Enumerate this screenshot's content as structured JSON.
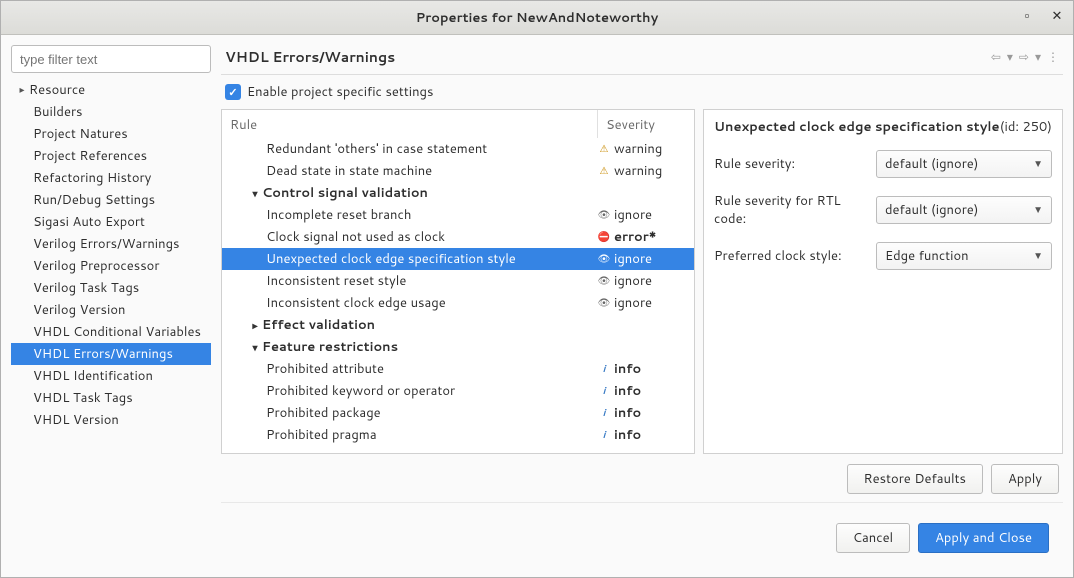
{
  "window": {
    "title": "Properties for NewAndNoteworthy"
  },
  "filter": {
    "placeholder": "type filter text"
  },
  "tree": {
    "items": [
      {
        "label": "Resource",
        "expandable": true,
        "level": 0
      },
      {
        "label": "Builders",
        "level": 1
      },
      {
        "label": "Project Natures",
        "level": 1
      },
      {
        "label": "Project References",
        "level": 1
      },
      {
        "label": "Refactoring History",
        "level": 1
      },
      {
        "label": "Run/Debug Settings",
        "level": 1
      },
      {
        "label": "Sigasi Auto Export",
        "level": 1
      },
      {
        "label": "Verilog Errors/Warnings",
        "level": 1
      },
      {
        "label": "Verilog Preprocessor",
        "level": 1
      },
      {
        "label": "Verilog Task Tags",
        "level": 1
      },
      {
        "label": "Verilog Version",
        "level": 1
      },
      {
        "label": "VHDL Conditional Variables",
        "level": 1
      },
      {
        "label": "VHDL Errors/Warnings",
        "level": 1,
        "selected": true
      },
      {
        "label": "VHDL Identification",
        "level": 1
      },
      {
        "label": "VHDL Task Tags",
        "level": 1
      },
      {
        "label": "VHDL Version",
        "level": 1
      }
    ]
  },
  "page": {
    "title": "VHDL Errors/Warnings",
    "enable_label": "Enable project specific settings",
    "enable_checked": true
  },
  "rules": {
    "header": {
      "rule": "Rule",
      "severity": "Severity"
    },
    "rows": [
      {
        "name": "Redundant 'others' in case statement",
        "indent": 2,
        "sev": "warning",
        "sevkind": "warning"
      },
      {
        "name": "Dead state in state machine",
        "indent": 2,
        "sev": "warning",
        "sevkind": "warning"
      },
      {
        "name": "Control signal validation",
        "indent": 1,
        "bold": true,
        "expandable": true,
        "expanded": true
      },
      {
        "name": "Incomplete reset branch",
        "indent": 2,
        "sev": "ignore",
        "sevkind": "ignore"
      },
      {
        "name": "Clock signal not used as clock",
        "indent": 2,
        "sev": "error*",
        "sevkind": "error"
      },
      {
        "name": "Unexpected clock edge specification style",
        "indent": 2,
        "sev": "ignore",
        "sevkind": "ignore",
        "selected": true
      },
      {
        "name": "Inconsistent reset style",
        "indent": 2,
        "sev": "ignore",
        "sevkind": "ignore"
      },
      {
        "name": "Inconsistent clock edge usage",
        "indent": 2,
        "sev": "ignore",
        "sevkind": "ignore"
      },
      {
        "name": "Effect validation",
        "indent": 1,
        "bold": true,
        "expandable": true,
        "expanded": false
      },
      {
        "name": "Feature restrictions",
        "indent": 1,
        "bold": true,
        "expandable": true,
        "expanded": true
      },
      {
        "name": "Prohibited attribute",
        "indent": 2,
        "sev": "info",
        "sevkind": "info"
      },
      {
        "name": "Prohibited keyword or operator",
        "indent": 2,
        "sev": "info",
        "sevkind": "info"
      },
      {
        "name": "Prohibited package",
        "indent": 2,
        "sev": "info",
        "sevkind": "info"
      },
      {
        "name": "Prohibited pragma",
        "indent": 2,
        "sev": "info",
        "sevkind": "info"
      }
    ]
  },
  "detail": {
    "title": "Unexpected clock edge specification style",
    "id": "(id: 250)",
    "fields": [
      {
        "label": "Rule severity:",
        "value": "default (ignore)"
      },
      {
        "label": "Rule severity for RTL code:",
        "value": "default (ignore)"
      },
      {
        "label": "Preferred clock style:",
        "value": "Edge function"
      }
    ]
  },
  "buttons": {
    "restore": "Restore Defaults",
    "apply": "Apply",
    "cancel": "Cancel",
    "applyclose": "Apply and Close"
  }
}
